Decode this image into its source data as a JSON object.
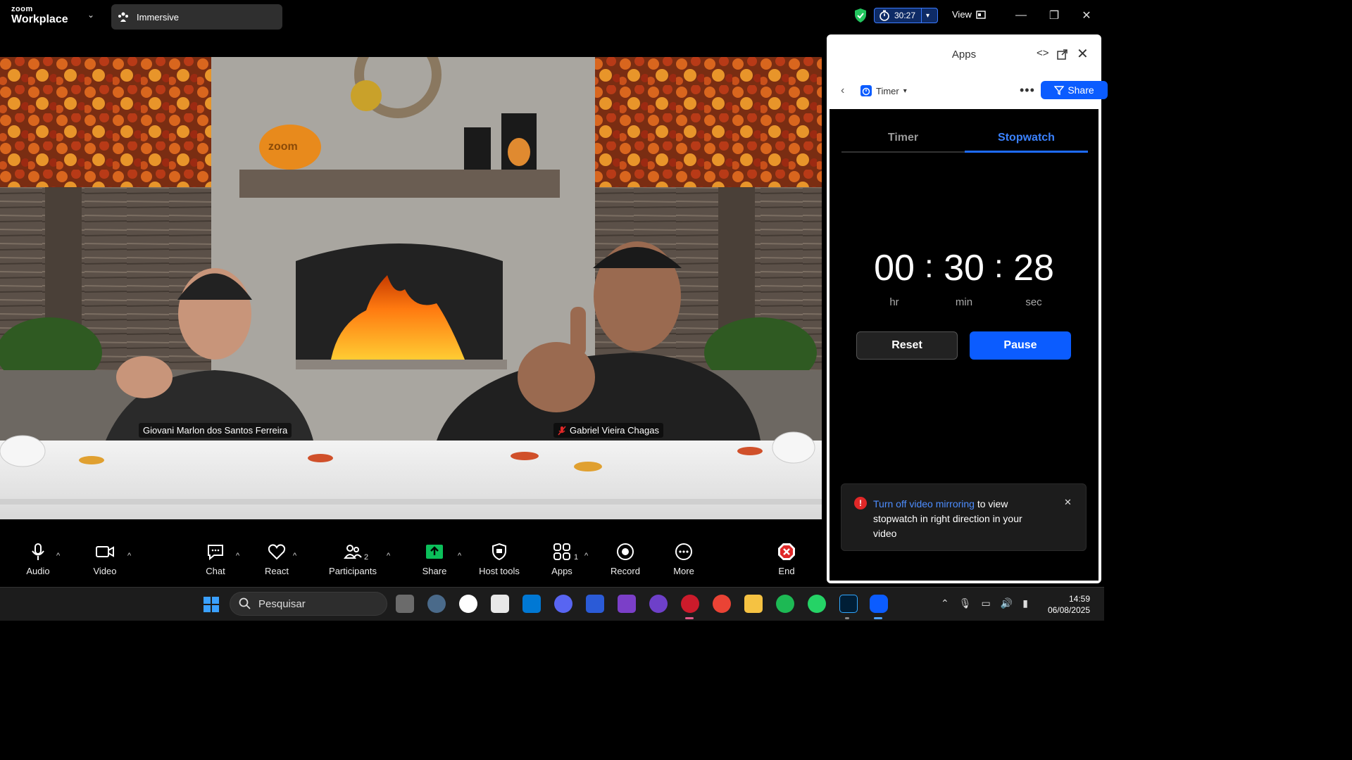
{
  "titlebar": {
    "logo_small": "zoom",
    "logo_big": "Workplace",
    "immersive_label": "Immersive",
    "timer_value": "30:27",
    "view_label": "View",
    "minimize": "—",
    "restore": "❐",
    "close": "✕"
  },
  "video": {
    "participants": [
      {
        "name": "Giovani Marlon dos Santos Ferreira",
        "muted": false
      },
      {
        "name": "Gabriel Vieira Chagas",
        "muted": true
      }
    ]
  },
  "toolbar": {
    "audio": "Audio",
    "video": "Video",
    "chat": "Chat",
    "react": "React",
    "participants": "Participants",
    "participants_count": "2",
    "share": "Share",
    "host_tools": "Host tools",
    "apps": "Apps",
    "apps_count": "1",
    "record": "Record",
    "more": "More",
    "end": "End",
    "caret": "^"
  },
  "panel": {
    "title": "Apps",
    "app_name": "Timer",
    "share_label": "Share",
    "tabs": [
      {
        "label": "Timer",
        "active": false
      },
      {
        "label": "Stopwatch",
        "active": true
      }
    ],
    "stopwatch": {
      "hours": "00",
      "minutes": "30",
      "seconds": "28",
      "hr_label": "hr",
      "min_label": "min",
      "sec_label": "sec"
    },
    "reset_label": "Reset",
    "pause_label": "Pause",
    "notice": {
      "link_text": "Turn off video mirroring",
      "rest_text": " to view stopwatch in right direction in your video"
    }
  },
  "taskbar": {
    "search_placeholder": "Pesquisar",
    "time": "14:59",
    "date": "06/08/2025"
  },
  "colors": {
    "accent": "#0b5cff",
    "tab_active": "#3b82ff",
    "share_green": "#0bbf5a",
    "end_red": "#e02828"
  }
}
